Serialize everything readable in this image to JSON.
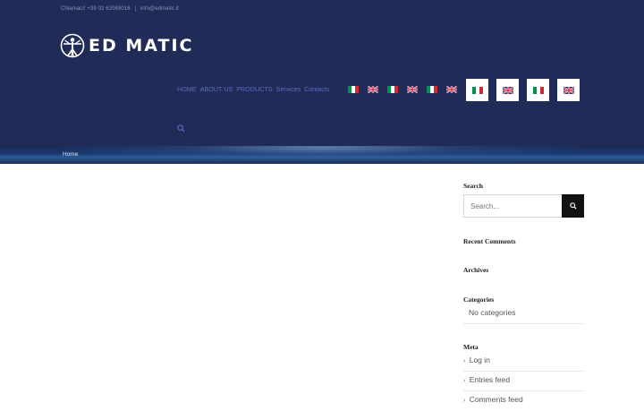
{
  "topbar": {
    "phone": "Chiamaci! +39 02 62069016",
    "separator": "|",
    "email": "info@edmatic.it"
  },
  "logo": {
    "text": "ED MATIC",
    "icon": "vitruvian-man-icon"
  },
  "nav": {
    "items": [
      "HOME",
      "ABOUT US",
      "PRODUCTS",
      "Services",
      "Contacts"
    ],
    "flags_small": [
      "it",
      "gb",
      "it",
      "gb",
      "it",
      "gb"
    ],
    "flags_boxed": [
      "it",
      "gb",
      "it",
      "gb"
    ],
    "search_icon": "search-icon"
  },
  "breadcrumb": {
    "home": "Home"
  },
  "sidebar": {
    "search": {
      "title": "Search",
      "placeholder": "Search..."
    },
    "recent_comments": {
      "title": "Recent Comments"
    },
    "archives": {
      "title": "Archives"
    },
    "categories": {
      "title": "Categories",
      "items": [
        "No categories"
      ]
    },
    "meta": {
      "title": "Meta",
      "items": [
        "Log in",
        "Entries feed",
        "Comments feed"
      ]
    }
  },
  "colors": {
    "header_bg": "#212b57",
    "nav_text": "#5a6cbf",
    "search_button": "#111111",
    "flag_it": [
      "#009246",
      "#ffffff",
      "#ce2b37"
    ],
    "flag_gb_blue": "#012169",
    "flag_gb_red": "#c8102e"
  }
}
